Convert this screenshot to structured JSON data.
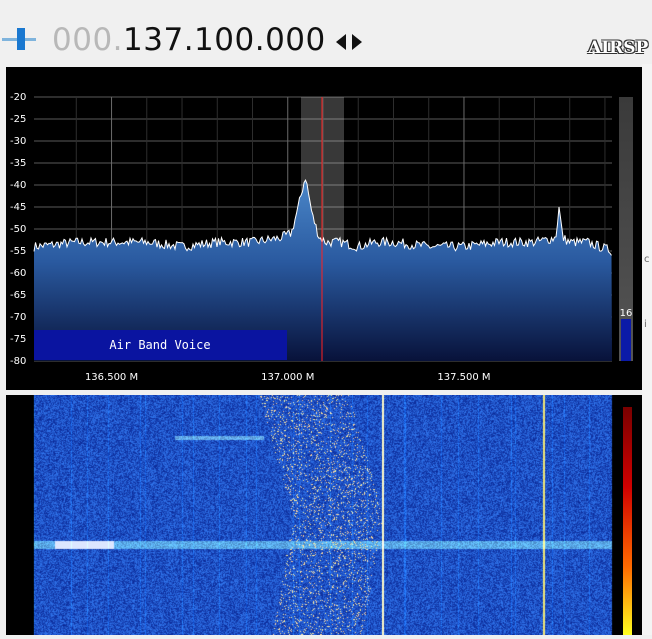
{
  "frequency": {
    "leading": "000.",
    "value": "137.100.000"
  },
  "logo": "AIRSP",
  "spectrum": {
    "y_ticks": [
      "-20",
      "-25",
      "-30",
      "-35",
      "-40",
      "-45",
      "-50",
      "-55",
      "-60",
      "-65",
      "-70",
      "-75",
      "-80"
    ],
    "x_ticks": [
      "136.500 M",
      "137.000 M",
      "137.500 M"
    ],
    "band_label": "Air Band Voice",
    "side_bar_value": "16"
  },
  "colors": {
    "spectrum_fill_top": "#4a86c8",
    "spectrum_fill_bottom": "#08123a",
    "tuning_line": "#ff2020",
    "band_plan": "#0a14a0",
    "waterfall_base": "#1636b4"
  },
  "chart_data": {
    "type": "area",
    "xlabel": "",
    "ylabel": "",
    "xlim": [
      136.28,
      137.92
    ],
    "ylim": [
      -80,
      -20
    ],
    "x": [
      136.28,
      136.4,
      136.5,
      136.6,
      136.7,
      136.8,
      136.9,
      136.98,
      137.01,
      137.03,
      137.05,
      137.07,
      137.09,
      137.11,
      137.15,
      137.2,
      137.25,
      137.3,
      137.4,
      137.5,
      137.6,
      137.7,
      137.76,
      137.77,
      137.78,
      137.8,
      137.85,
      137.92
    ],
    "series": [
      {
        "values": [
          -54,
          -53,
          -53,
          -53,
          -54,
          -53,
          -53,
          -52,
          -51,
          -45,
          -38,
          -47,
          -52,
          -53,
          -53,
          -54,
          -53,
          -53,
          -54,
          -54,
          -53,
          -53,
          -52,
          -45,
          -52,
          -53,
          -53,
          -55
        ]
      }
    ],
    "markers": [
      {
        "label": "tuning",
        "x": 137.1
      }
    ],
    "bands": [
      {
        "label": "Air Band Voice",
        "x_start": 136.28,
        "x_end": 137.0
      }
    ]
  }
}
